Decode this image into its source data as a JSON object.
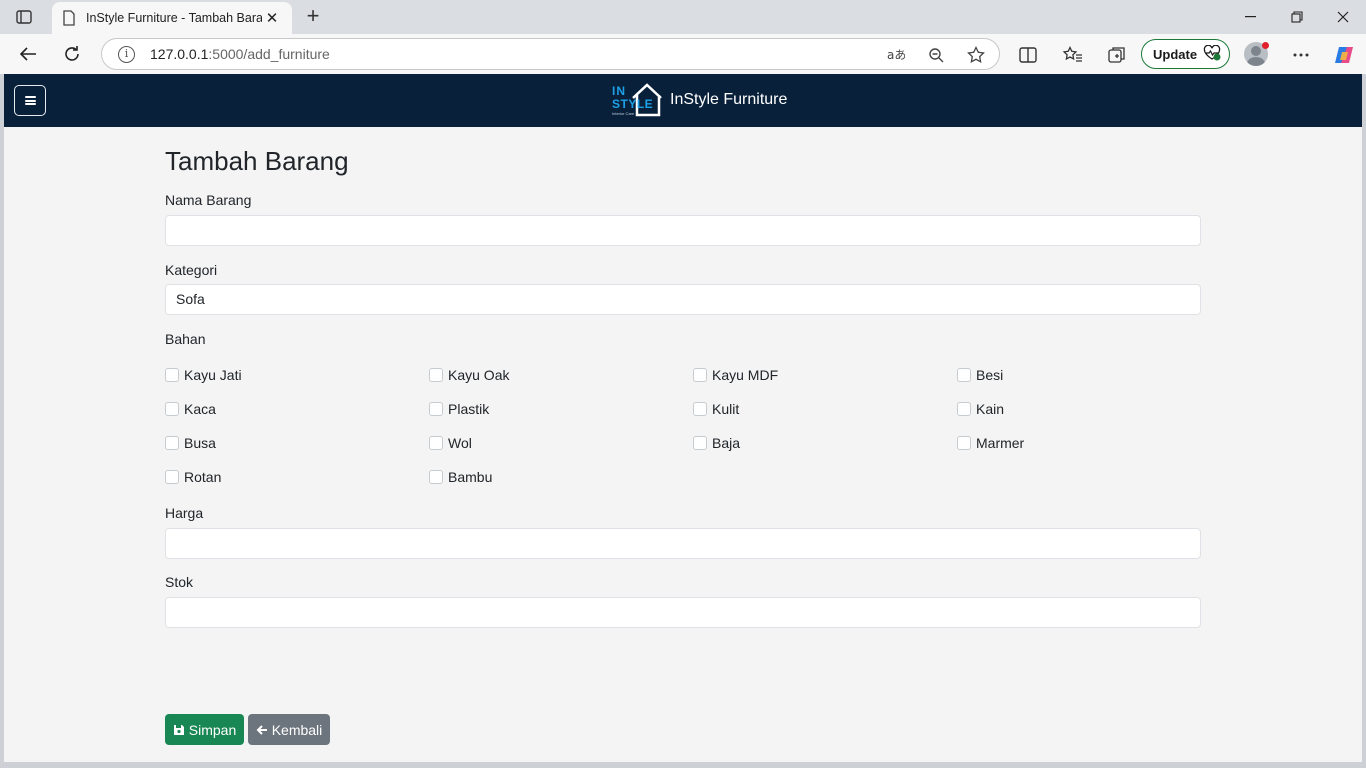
{
  "browser": {
    "tab_title": "InStyle Furniture - Tambah Barang",
    "tab_close": "✕",
    "new_tab": "+",
    "url_host": "127.0.0.1",
    "url_path": ":5000/add_furniture",
    "update_label": "Update"
  },
  "navbar": {
    "brand_name": "InStyle Furniture",
    "logo_in": "IN",
    "logo_style": "STYLE",
    "logo_tag": "Interior Care"
  },
  "form": {
    "title": "Tambah Barang",
    "nama_label": "Nama Barang",
    "nama_value": "",
    "kategori_label": "Kategori",
    "kategori_value": "Sofa",
    "bahan_label": "Bahan",
    "bahan_options": [
      "Kayu Jati",
      "Kayu Oak",
      "Kayu MDF",
      "Besi",
      "Kaca",
      "Plastik",
      "Kulit",
      "Kain",
      "Busa",
      "Wol",
      "Baja",
      "Marmer",
      "Rotan",
      "Bambu"
    ],
    "harga_label": "Harga",
    "harga_value": "",
    "stok_label": "Stok",
    "stok_value": "",
    "save_label": "Simpan",
    "back_label": "Kembali"
  }
}
